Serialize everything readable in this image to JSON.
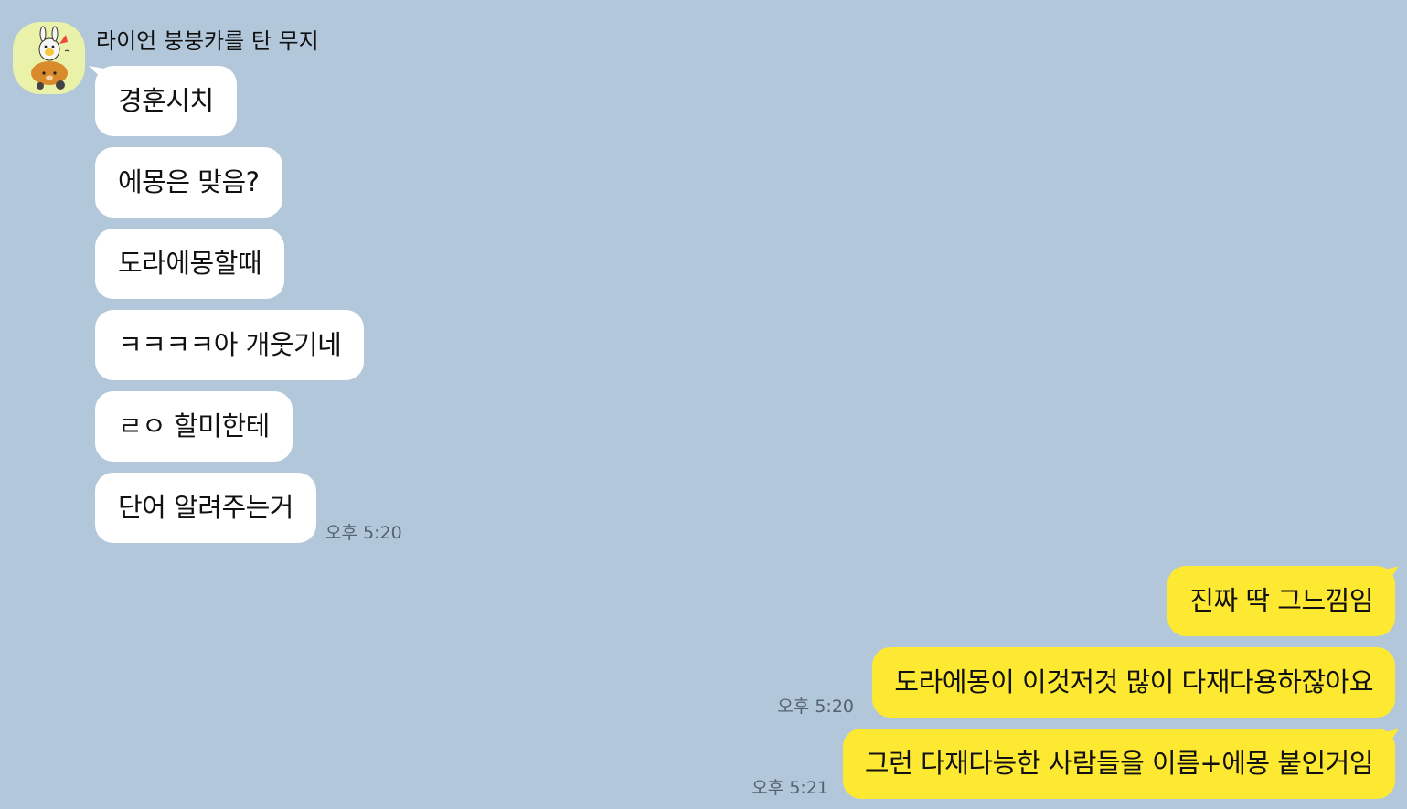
{
  "sender": {
    "name": "라이언 붕붕카를 탄 무지",
    "avatar_icon": "muzi-riding-ryan-avatar"
  },
  "incoming_messages": [
    {
      "text": "경훈시치"
    },
    {
      "text": "에몽은 맞음?"
    },
    {
      "text": "도라에몽할때"
    },
    {
      "text": "ㅋㅋㅋㅋ아 개웃기네"
    },
    {
      "text": "ㄹㅇ 할미한테"
    },
    {
      "text": "단어 알려주는거"
    }
  ],
  "incoming_time": "오후 5:20",
  "outgoing_messages": [
    {
      "text": "진짜 딱 그느낌임"
    },
    {
      "text": "도라에몽이 이것저것 많이 다재다용하잖아요"
    },
    {
      "text": "그런 다재다능한 사람들을 이름+에몽 붙인거임"
    }
  ],
  "outgoing_times": [
    "오후 5:20",
    "오후 5:21"
  ],
  "colors": {
    "chat_background": "#b2c7da",
    "incoming_bubble": "#ffffff",
    "outgoing_bubble": "#fee932",
    "avatar_background": "#e9f2a8"
  }
}
